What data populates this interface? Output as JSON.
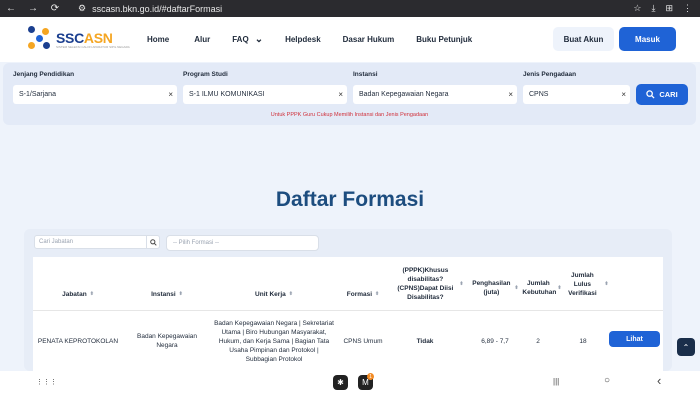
{
  "browser": {
    "back_icon": "←",
    "forward_icon": "→",
    "reload_icon": "⟳",
    "url": "sscasn.bkn.go.id/#daftarFormasi",
    "tools": [
      "☆",
      "⤓",
      "⊞",
      "⋮"
    ]
  },
  "header": {
    "logo_main": "SSC",
    "logo_accent": "ASN",
    "logo_tagline": "SISTEM SELEKSI CALON APARATUR SIPIL NEGARA",
    "nav": [
      "Home",
      "Alur",
      "FAQ",
      "Helpdesk",
      "Dasar Hukum",
      "Buku Petunjuk"
    ],
    "faq_chevron": "⌄",
    "buat_akun": "Buat Akun",
    "masuk": "Masuk"
  },
  "filter": {
    "jenjang": {
      "label": "Jenjang Pendidikan",
      "value": "S-1/Sarjana"
    },
    "prodi": {
      "label": "Program Studi",
      "value": "S-1 ILMU KOMUNIKASI"
    },
    "instansi": {
      "label": "Instansi",
      "value": "Badan Kepegawaian Negara"
    },
    "jenis": {
      "label": "Jenis Pengadaan",
      "value": "CPNS"
    },
    "clear": "×",
    "cari": "CARI",
    "note": "Untuk PPPK Guru Cukup Memilih Instansi dan Jenis Pengadaan"
  },
  "title": "Daftar Formasi",
  "table": {
    "search_placeholder": "Cari Jabatan",
    "formasi_placeholder": "-- Pilih Formasi --",
    "sort_icon": "⬍",
    "headers": {
      "jabatan": "Jabatan",
      "instansi": "Instansi",
      "unit_kerja": "Unit Kerja",
      "formasi": "Formasi",
      "disabilitas": "(PPPK)Khusus disabilitas? (CPNS)Dapat Diisi Disabilitas?",
      "penghasilan": "Penghasilan (juta)",
      "kebutuhan": "Jumlah Kebutuhan",
      "lulus": "Jumlah Lulus Verifikasi"
    },
    "rows": [
      {
        "jabatan": "PENATA KEPROTOKOLAN",
        "instansi": "Badan Kepegawaian Negara",
        "unit_kerja": "Badan Kepegawaian Negara | Sekretariat Utama | Biro Hubungan Masyarakat, Hukum, dan Kerja Sama | Bagian Tata Usaha Pimpinan dan Protokol | Subbagian Protokol",
        "formasi": "CPNS Umum",
        "disabilitas": "Tidak",
        "penghasilan": "6,89 - 7,7",
        "kebutuhan": "2",
        "lulus": "18",
        "action": "Lihat"
      }
    ]
  },
  "scroll_top_icon": "⌃",
  "android": {
    "apps_icon": "⋮⋮⋮",
    "recent_icon": "|||",
    "home_icon": "○",
    "back_icon": "‹",
    "badge": "1"
  },
  "colors": {
    "primary": "#1f63d6",
    "title": "#1d4d7f",
    "note": "#d0313b",
    "logo_accent": "#f5a623"
  }
}
